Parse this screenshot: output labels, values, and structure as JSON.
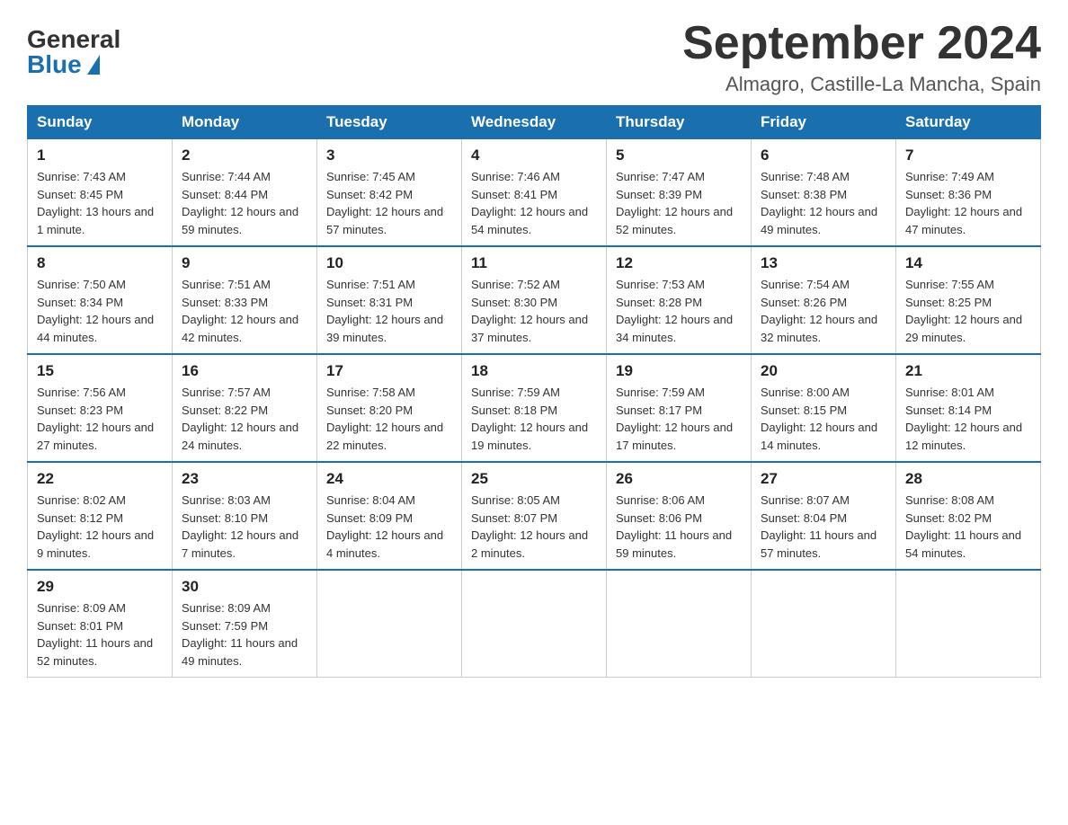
{
  "header": {
    "logo_general": "General",
    "logo_blue": "Blue",
    "month_year": "September 2024",
    "location": "Almagro, Castille-La Mancha, Spain"
  },
  "weekdays": [
    "Sunday",
    "Monday",
    "Tuesday",
    "Wednesday",
    "Thursday",
    "Friday",
    "Saturday"
  ],
  "weeks": [
    [
      {
        "day": "1",
        "sunrise": "7:43 AM",
        "sunset": "8:45 PM",
        "daylight": "13 hours and 1 minute."
      },
      {
        "day": "2",
        "sunrise": "7:44 AM",
        "sunset": "8:44 PM",
        "daylight": "12 hours and 59 minutes."
      },
      {
        "day": "3",
        "sunrise": "7:45 AM",
        "sunset": "8:42 PM",
        "daylight": "12 hours and 57 minutes."
      },
      {
        "day": "4",
        "sunrise": "7:46 AM",
        "sunset": "8:41 PM",
        "daylight": "12 hours and 54 minutes."
      },
      {
        "day": "5",
        "sunrise": "7:47 AM",
        "sunset": "8:39 PM",
        "daylight": "12 hours and 52 minutes."
      },
      {
        "day": "6",
        "sunrise": "7:48 AM",
        "sunset": "8:38 PM",
        "daylight": "12 hours and 49 minutes."
      },
      {
        "day": "7",
        "sunrise": "7:49 AM",
        "sunset": "8:36 PM",
        "daylight": "12 hours and 47 minutes."
      }
    ],
    [
      {
        "day": "8",
        "sunrise": "7:50 AM",
        "sunset": "8:34 PM",
        "daylight": "12 hours and 44 minutes."
      },
      {
        "day": "9",
        "sunrise": "7:51 AM",
        "sunset": "8:33 PM",
        "daylight": "12 hours and 42 minutes."
      },
      {
        "day": "10",
        "sunrise": "7:51 AM",
        "sunset": "8:31 PM",
        "daylight": "12 hours and 39 minutes."
      },
      {
        "day": "11",
        "sunrise": "7:52 AM",
        "sunset": "8:30 PM",
        "daylight": "12 hours and 37 minutes."
      },
      {
        "day": "12",
        "sunrise": "7:53 AM",
        "sunset": "8:28 PM",
        "daylight": "12 hours and 34 minutes."
      },
      {
        "day": "13",
        "sunrise": "7:54 AM",
        "sunset": "8:26 PM",
        "daylight": "12 hours and 32 minutes."
      },
      {
        "day": "14",
        "sunrise": "7:55 AM",
        "sunset": "8:25 PM",
        "daylight": "12 hours and 29 minutes."
      }
    ],
    [
      {
        "day": "15",
        "sunrise": "7:56 AM",
        "sunset": "8:23 PM",
        "daylight": "12 hours and 27 minutes."
      },
      {
        "day": "16",
        "sunrise": "7:57 AM",
        "sunset": "8:22 PM",
        "daylight": "12 hours and 24 minutes."
      },
      {
        "day": "17",
        "sunrise": "7:58 AM",
        "sunset": "8:20 PM",
        "daylight": "12 hours and 22 minutes."
      },
      {
        "day": "18",
        "sunrise": "7:59 AM",
        "sunset": "8:18 PM",
        "daylight": "12 hours and 19 minutes."
      },
      {
        "day": "19",
        "sunrise": "7:59 AM",
        "sunset": "8:17 PM",
        "daylight": "12 hours and 17 minutes."
      },
      {
        "day": "20",
        "sunrise": "8:00 AM",
        "sunset": "8:15 PM",
        "daylight": "12 hours and 14 minutes."
      },
      {
        "day": "21",
        "sunrise": "8:01 AM",
        "sunset": "8:14 PM",
        "daylight": "12 hours and 12 minutes."
      }
    ],
    [
      {
        "day": "22",
        "sunrise": "8:02 AM",
        "sunset": "8:12 PM",
        "daylight": "12 hours and 9 minutes."
      },
      {
        "day": "23",
        "sunrise": "8:03 AM",
        "sunset": "8:10 PM",
        "daylight": "12 hours and 7 minutes."
      },
      {
        "day": "24",
        "sunrise": "8:04 AM",
        "sunset": "8:09 PM",
        "daylight": "12 hours and 4 minutes."
      },
      {
        "day": "25",
        "sunrise": "8:05 AM",
        "sunset": "8:07 PM",
        "daylight": "12 hours and 2 minutes."
      },
      {
        "day": "26",
        "sunrise": "8:06 AM",
        "sunset": "8:06 PM",
        "daylight": "11 hours and 59 minutes."
      },
      {
        "day": "27",
        "sunrise": "8:07 AM",
        "sunset": "8:04 PM",
        "daylight": "11 hours and 57 minutes."
      },
      {
        "day": "28",
        "sunrise": "8:08 AM",
        "sunset": "8:02 PM",
        "daylight": "11 hours and 54 minutes."
      }
    ],
    [
      {
        "day": "29",
        "sunrise": "8:09 AM",
        "sunset": "8:01 PM",
        "daylight": "11 hours and 52 minutes."
      },
      {
        "day": "30",
        "sunrise": "8:09 AM",
        "sunset": "7:59 PM",
        "daylight": "11 hours and 49 minutes."
      },
      null,
      null,
      null,
      null,
      null
    ]
  ]
}
